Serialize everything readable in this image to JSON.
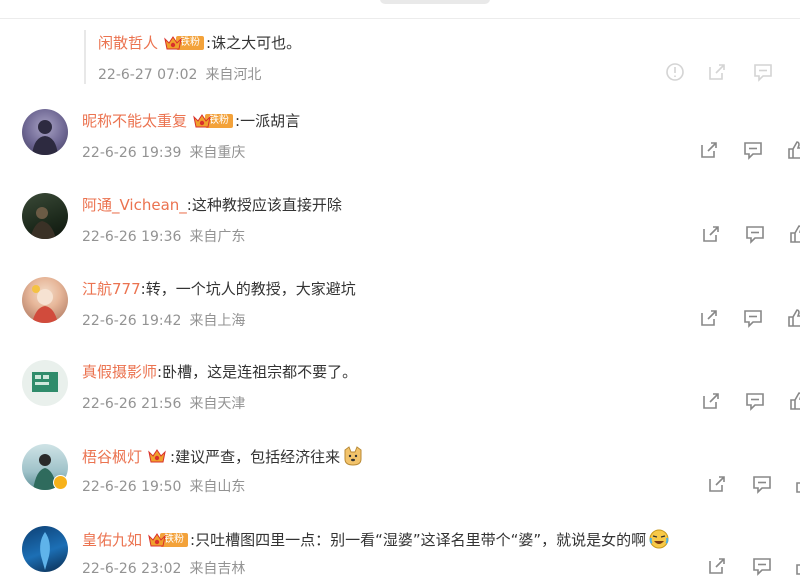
{
  "top_reply": {
    "username": "闲散哲人",
    "badge": "铁粉",
    "text": ":诛之大可也。",
    "date": "22-6-27 07:02",
    "location": "来自河北"
  },
  "comments": [
    {
      "username": "昵称不能太重复",
      "badge": "铁粉",
      "text": ":一派胡言",
      "date": "22-6-26 19:39",
      "location": "来自重庆"
    },
    {
      "username": "阿通_Vichean_",
      "badge": "",
      "text": ":这种教授应该直接开除",
      "date": "22-6-26 19:36",
      "location": "来自广东"
    },
    {
      "username": "江航777",
      "badge": "",
      "text": ":转，一个坑人的教授，大家避坑",
      "date": "22-6-26 19:42",
      "location": "来自上海"
    },
    {
      "username": "真假摄影师",
      "badge": "",
      "text": ":卧槽，这是连祖宗都不要了。",
      "date": "22-6-26 21:56",
      "location": "来自天津"
    },
    {
      "username": "梧谷枫灯",
      "badge": "",
      "text": ":建议严查，包括经济往来",
      "date": "22-6-26 19:50",
      "location": "来自山东"
    },
    {
      "username": "皇佑九如",
      "badge": "铁粉",
      "text": ":只吐槽图四里一点：别一看“湿婆”这译名里带个“婆”，就说是女的啊",
      "date": "22-6-26 23:02",
      "location": "来自吉林"
    }
  ],
  "icons": {
    "share": "share-icon",
    "comment": "comment-icon",
    "like": "thumbs-up-icon"
  },
  "colors": {
    "username": "#eb7350",
    "meta": "#939393",
    "icon": "#888888",
    "badge": "#f3a23a"
  }
}
